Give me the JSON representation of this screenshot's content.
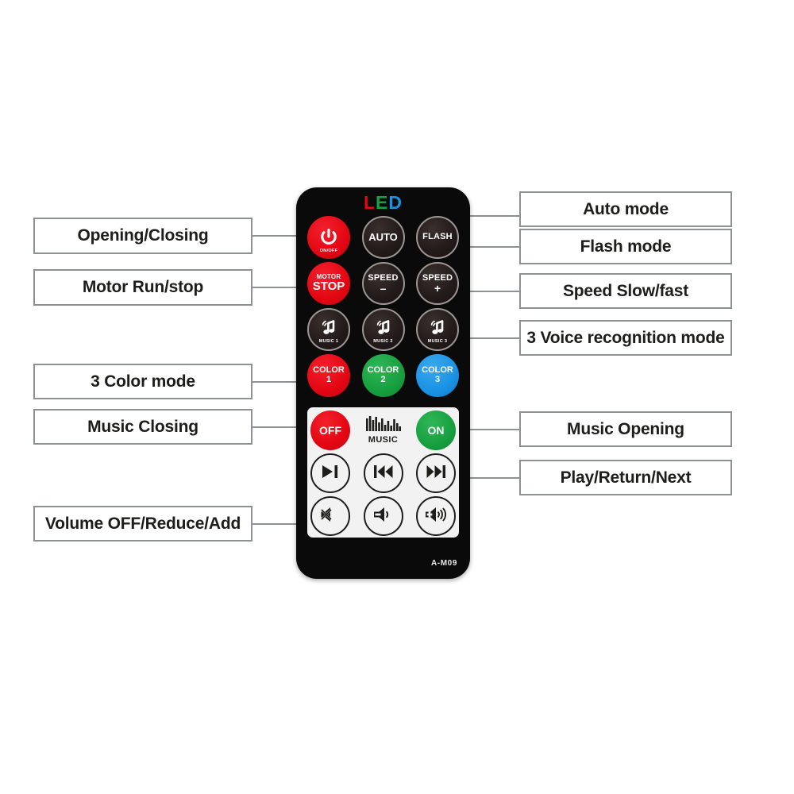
{
  "product": {
    "brand_logo": "LED",
    "brand_logo_letters": [
      {
        "ch": "L",
        "color": "#e30613"
      },
      {
        "ch": "E",
        "color": "#17a03f"
      },
      {
        "ch": "D",
        "color": "#1a92e3"
      }
    ],
    "model": "A-M09"
  },
  "keys": {
    "power": {
      "tiny": "ON/OFF",
      "icon": "power-icon"
    },
    "auto": {
      "label": "AUTO"
    },
    "flash": {
      "label": "FLASH"
    },
    "motor_stop": {
      "line1": "MOTOR",
      "line2": "STOP"
    },
    "speed_minus": {
      "label": "SPEED",
      "sign": "–"
    },
    "speed_plus": {
      "label": "SPEED",
      "sign": "+"
    },
    "music1": {
      "tiny": "MUSIC 1",
      "icon": "music-note-icon"
    },
    "music2": {
      "tiny": "MUSIC 2",
      "icon": "music-note-icon"
    },
    "music3": {
      "tiny": "MUSIC 3",
      "icon": "music-note-icon"
    },
    "color1": {
      "name": "COLOR",
      "num": "1",
      "color": "#e30613"
    },
    "color2": {
      "name": "COLOR",
      "num": "2",
      "color": "#17a03f"
    },
    "color3": {
      "name": "COLOR",
      "num": "3",
      "color": "#1a92e3"
    },
    "off": {
      "label": "OFF"
    },
    "music_logo": {
      "label": "MUSIC",
      "icon": "equalizer-icon"
    },
    "on": {
      "label": "ON"
    },
    "play_pause": {
      "icon": "play-pause-icon"
    },
    "previous": {
      "icon": "previous-track-icon"
    },
    "next": {
      "icon": "next-track-icon"
    },
    "mute": {
      "icon": "volume-mute-icon"
    },
    "volume_down": {
      "icon": "volume-down-icon"
    },
    "volume_up": {
      "icon": "volume-up-icon"
    }
  },
  "callouts": {
    "left": [
      {
        "id": "opening-closing",
        "text": "Opening/Closing"
      },
      {
        "id": "motor-run-stop",
        "text": "Motor Run/stop"
      },
      {
        "id": "three-color-mode",
        "text": "3 Color mode"
      },
      {
        "id": "music-closing",
        "text": "Music Closing"
      },
      {
        "id": "volume-off-reduce-add",
        "text": "Volume OFF/Reduce/Add"
      }
    ],
    "right": [
      {
        "id": "auto-mode",
        "text": "Auto mode"
      },
      {
        "id": "flash-mode",
        "text": "Flash mode"
      },
      {
        "id": "speed-slow-fast",
        "text": "Speed Slow/fast"
      },
      {
        "id": "three-voice-recognition-mode",
        "text": "3 Voice recognition mode"
      },
      {
        "id": "music-opening",
        "text": "Music Opening"
      },
      {
        "id": "play-return-next",
        "text": "Play/Return/Next"
      }
    ]
  },
  "theme": {
    "background": "#ffffff",
    "callout_border": "#8d9194",
    "connector": "#8d9194",
    "body": "#0a0a0a",
    "panel": "#f2f2f2",
    "red": "#e30613",
    "green": "#17a03f",
    "blue": "#1a92e3"
  }
}
